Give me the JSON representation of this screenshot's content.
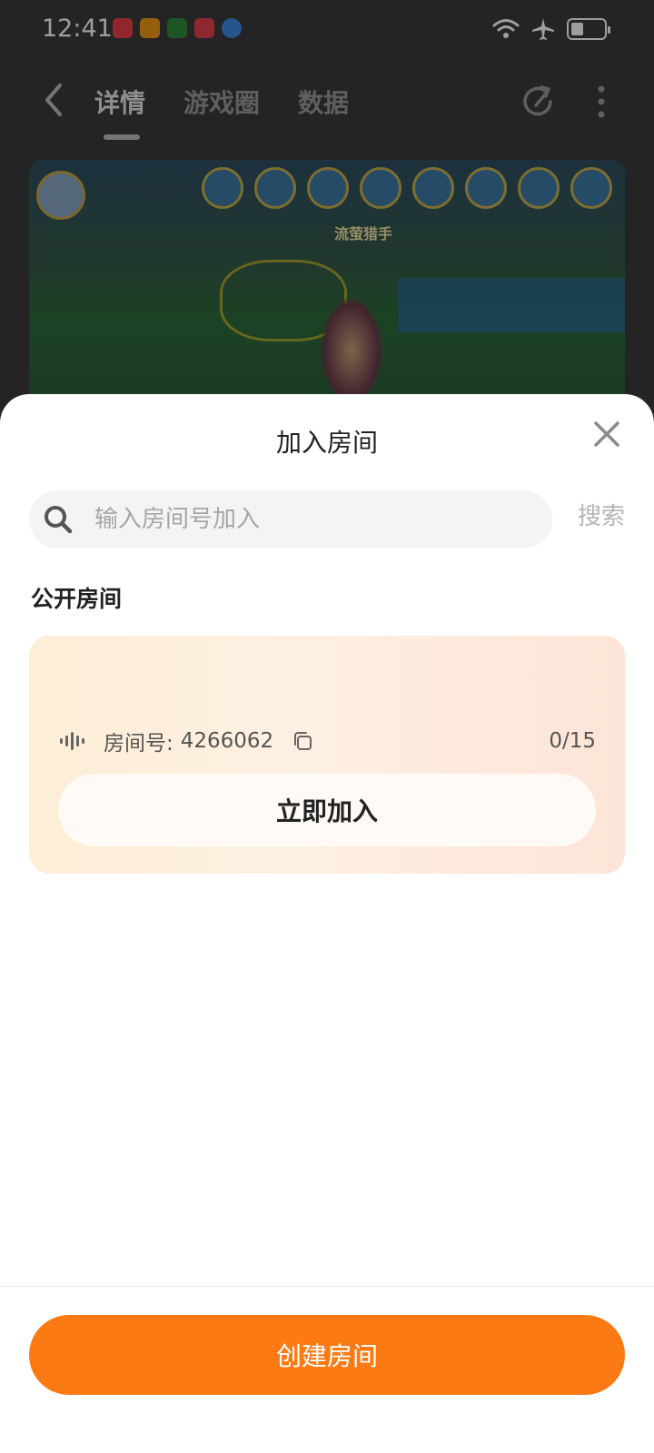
{
  "status_bar": {
    "time": "12:41",
    "icons": [
      "wifi-icon",
      "airplane-icon",
      "battery-icon"
    ]
  },
  "nav": {
    "tabs": [
      {
        "label": "详情",
        "active": true
      },
      {
        "label": "游戏圈",
        "active": false
      },
      {
        "label": "数据",
        "active": false
      }
    ]
  },
  "game_screenshot": {
    "label": "流萤猎手"
  },
  "sheet": {
    "title": "加入房间",
    "search": {
      "placeholder": "输入房间号加入",
      "button_label": "搜索"
    },
    "section_title": "公开房间",
    "rooms": [
      {
        "label": "房间号:",
        "number": "4266062",
        "count": "0/15",
        "join_label": "立即加入"
      }
    ],
    "create_label": "创建房间"
  },
  "colors": {
    "accent": "#fb7a14",
    "card_start": "#fdeed6",
    "card_end": "#fde4d7"
  }
}
